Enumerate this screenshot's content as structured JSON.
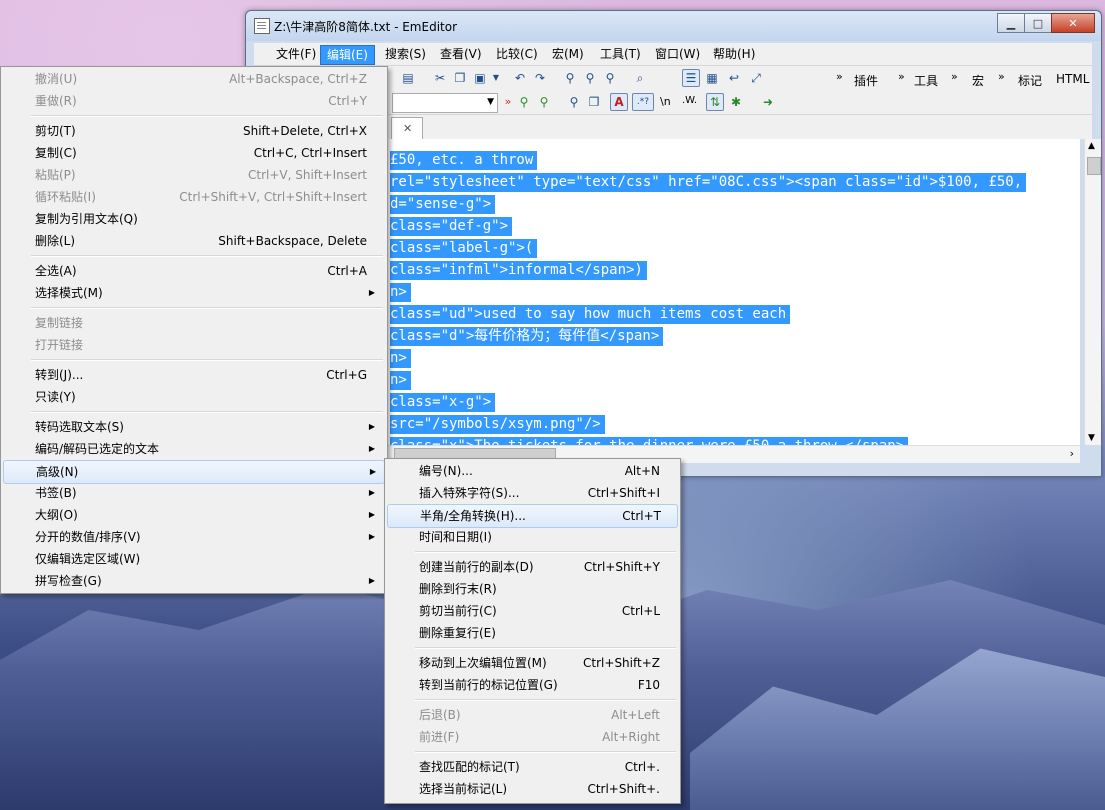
{
  "window": {
    "title": "Z:\\牛津高阶8简体.txt - EmEditor",
    "buttons": {
      "min": "▁",
      "max": "□",
      "close": "✕"
    }
  },
  "menubar": [
    {
      "label": "文件(F)",
      "active": false
    },
    {
      "label": "编辑(E)",
      "active": true
    },
    {
      "label": "搜索(S)",
      "active": false
    },
    {
      "label": "查看(V)",
      "active": false
    },
    {
      "label": "比较(C)",
      "active": false
    },
    {
      "label": "宏(M)",
      "active": false
    },
    {
      "label": "工具(T)",
      "active": false
    },
    {
      "label": "窗口(W)",
      "active": false
    },
    {
      "label": "帮助(H)",
      "active": false
    }
  ],
  "toolbar": {
    "labels": {
      "plugins": "插件",
      "tools": "工具",
      "macros": "宏",
      "marks": "标记",
      "html": "HTML"
    },
    "chevron": "»",
    "find_icons": {
      "newline": "\\n",
      "word": ".W."
    }
  },
  "editor": {
    "lines": [
      "£50, etc. a throw",
      "rel=\"stylesheet\" type=\"text/css\" href=\"08C.css\"><span class=\"id\">$100, £50,",
      "d=\"sense-g\">",
      "class=\"def-g\">",
      "class=\"label-g\">(",
      "class=\"infml\">informal</span>)",
      "n>",
      "class=\"ud\">used to say how much items cost each",
      "class=\"d\">每件价格为；每件值</span>",
      "n>",
      "n>",
      "class=\"x-g\">",
      "src=\"/symbols/xsym.png\"/>",
      "class=\"x\">The tickets for the dinner were £50 a throw.</span>"
    ]
  },
  "edit_menu": {
    "items": [
      {
        "label": "撤消(U)",
        "shortcut": "Alt+Backspace, Ctrl+Z",
        "disabled": true
      },
      {
        "label": "重做(R)",
        "shortcut": "Ctrl+Y",
        "disabled": true
      },
      {
        "label": "剪切(T)",
        "shortcut": "Shift+Delete, Ctrl+X",
        "disabled": false
      },
      {
        "label": "复制(C)",
        "shortcut": "Ctrl+C, Ctrl+Insert",
        "disabled": false
      },
      {
        "label": "粘贴(P)",
        "shortcut": "Ctrl+V, Shift+Insert",
        "disabled": true
      },
      {
        "label": "循环粘贴(I)",
        "shortcut": "Ctrl+Shift+V, Ctrl+Shift+Insert",
        "disabled": true
      },
      {
        "label": "复制为引用文本(Q)",
        "shortcut": "",
        "disabled": false
      },
      {
        "label": "删除(L)",
        "shortcut": "Shift+Backspace, Delete",
        "disabled": false
      },
      {
        "label": "全选(A)",
        "shortcut": "Ctrl+A",
        "disabled": false
      },
      {
        "label": "选择模式(M)",
        "shortcut": "",
        "disabled": false,
        "submenu": true
      },
      {
        "label": "复制链接",
        "shortcut": "",
        "disabled": true
      },
      {
        "label": "打开链接",
        "shortcut": "",
        "disabled": true
      },
      {
        "label": "转到(J)...",
        "shortcut": "Ctrl+G",
        "disabled": false
      },
      {
        "label": "只读(Y)",
        "shortcut": "",
        "disabled": false
      },
      {
        "label": "转码选取文本(S)",
        "shortcut": "",
        "disabled": false,
        "submenu": true
      },
      {
        "label": "编码/解码已选定的文本",
        "shortcut": "",
        "disabled": false,
        "submenu": true
      },
      {
        "label": "高级(N)",
        "shortcut": "",
        "disabled": false,
        "submenu": true,
        "highlighted": true
      },
      {
        "label": "书签(B)",
        "shortcut": "",
        "disabled": false,
        "submenu": true
      },
      {
        "label": "大纲(O)",
        "shortcut": "",
        "disabled": false,
        "submenu": true
      },
      {
        "label": "分开的数值/排序(V)",
        "shortcut": "",
        "disabled": false,
        "submenu": true
      },
      {
        "label": "仅编辑选定区域(W)",
        "shortcut": "",
        "disabled": false
      },
      {
        "label": "拼写检查(G)",
        "shortcut": "",
        "disabled": false,
        "submenu": true
      }
    ]
  },
  "advanced_menu": {
    "items": [
      {
        "label": "编号(N)...",
        "shortcut": "Alt+N",
        "disabled": false
      },
      {
        "label": "插入特殊字符(S)...",
        "shortcut": "Ctrl+Shift+I",
        "disabled": false
      },
      {
        "label": "半角/全角转换(H)...",
        "shortcut": "Ctrl+T",
        "disabled": false,
        "highlighted": true
      },
      {
        "label": "时间和日期(I)",
        "shortcut": "",
        "disabled": false
      },
      {
        "label": "创建当前行的副本(D)",
        "shortcut": "Ctrl+Shift+Y",
        "disabled": false
      },
      {
        "label": "删除到行末(R)",
        "shortcut": "",
        "disabled": false
      },
      {
        "label": "剪切当前行(C)",
        "shortcut": "Ctrl+L",
        "disabled": false
      },
      {
        "label": "删除重复行(E)",
        "shortcut": "",
        "disabled": false
      },
      {
        "label": "移动到上次编辑位置(M)",
        "shortcut": "Ctrl+Shift+Z",
        "disabled": false
      },
      {
        "label": "转到当前行的标记位置(G)",
        "shortcut": "F10",
        "disabled": false
      },
      {
        "label": "后退(B)",
        "shortcut": "Alt+Left",
        "disabled": true
      },
      {
        "label": "前进(F)",
        "shortcut": "Alt+Right",
        "disabled": true
      },
      {
        "label": "查找匹配的标记(T)",
        "shortcut": "Ctrl+.",
        "disabled": false
      },
      {
        "label": "选择当前标记(L)",
        "shortcut": "Ctrl+Shift+.",
        "disabled": false
      }
    ]
  },
  "colors": {
    "selection": "#3399ff",
    "menu_bg": "#f0f0f0",
    "disabled_text": "#8d8d8d"
  }
}
